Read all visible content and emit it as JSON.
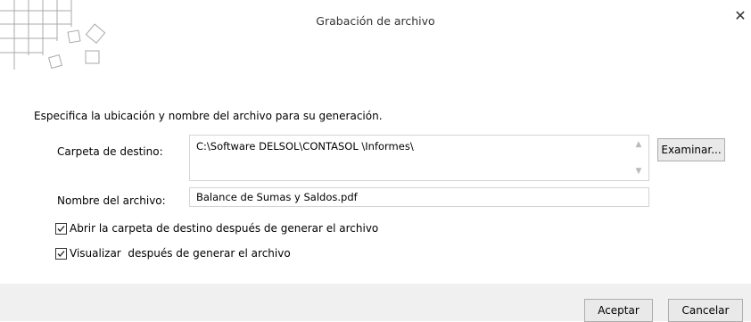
{
  "dialog": {
    "title": "Grabación de archivo",
    "close_symbol": "✕",
    "instruction": "Especifica la ubicación y nombre del archivo para su generación.",
    "destination_folder": {
      "label": "Carpeta de destino:",
      "value": "C:\\Software DELSOL\\CONTASOL \\Informes\\",
      "browse_label": "Examinar..."
    },
    "file_name": {
      "label": "Nombre del archivo:",
      "value": "Balance de Sumas y Saldos.pdf"
    },
    "options": [
      {
        "label": "Abrir la carpeta de destino después de generar el archivo",
        "checked": true
      },
      {
        "label": "Visualizar  después de generar el archivo",
        "checked": true
      }
    ],
    "buttons": {
      "ok": "Aceptar",
      "cancel": "Cancelar"
    }
  },
  "icons": {
    "logo": "grid-squares-logo",
    "close": "close-icon",
    "scroll_up": "scroll-up-icon",
    "scroll_down": "scroll-down-icon",
    "checkbox": "checkmark-icon"
  }
}
